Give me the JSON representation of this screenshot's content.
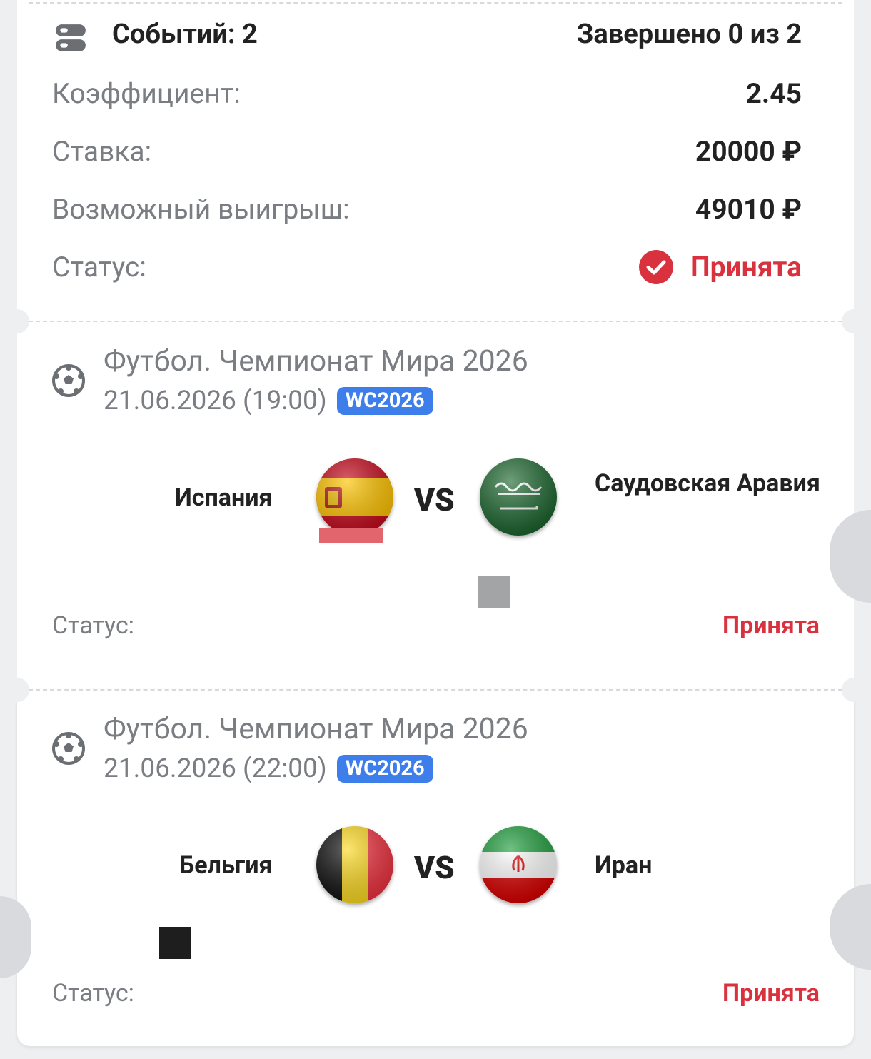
{
  "summary": {
    "events_label": "Событий: 2",
    "completed_label": "Завершено 0 из 2",
    "coef_label": "Коэффициент:",
    "coef_value": "2.45",
    "stake_label": "Ставка:",
    "stake_value": "20000 ₽",
    "win_label": "Возможный выигрыш:",
    "win_value": "49010 ₽",
    "status_label": "Статус:",
    "status_value": "Принята"
  },
  "events": [
    {
      "league": "Футбол. Чемпионат Мира 2026",
      "datetime": "21.06.2026 (19:00)",
      "badge": "WC2026",
      "team1": "Испания",
      "team2": "Саудовская Аравия",
      "vs": "VS",
      "status_label": "Статус:",
      "status_value": "Принята",
      "flag1": "spain-flag-icon",
      "flag2": "saudi-arabia-flag-icon"
    },
    {
      "league": "Футбол. Чемпионат Мира 2026",
      "datetime": "21.06.2026 (22:00)",
      "badge": "WC2026",
      "team1": "Бельгия",
      "team2": "Иран",
      "vs": "VS",
      "status_label": "Статус:",
      "status_value": "Принята",
      "flag1": "belgium-flag-icon",
      "flag2": "iran-flag-icon"
    }
  ],
  "colors": {
    "accent_red": "#d9323e",
    "badge_blue": "#3d7eea",
    "text_gray": "#7a7d82",
    "background": "#eeeff1"
  }
}
